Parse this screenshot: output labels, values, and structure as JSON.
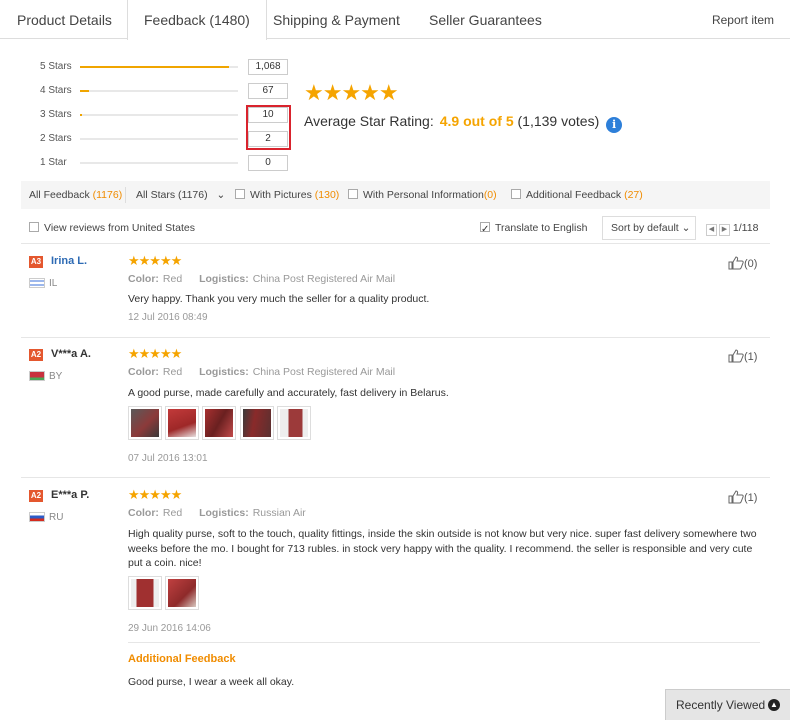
{
  "tabs": [
    {
      "label": "Product Details"
    },
    {
      "label": "Feedback (1480)"
    },
    {
      "label": "Shipping & Payment"
    },
    {
      "label": "Seller Guarantees"
    }
  ],
  "report_label": "Report item",
  "distribution": [
    {
      "label": "5 Stars",
      "count": "1,068",
      "fraction": 0.94
    },
    {
      "label": "4 Stars",
      "count": "67",
      "fraction": 0.06
    },
    {
      "label": "3 Stars",
      "count": "10",
      "fraction": 0.01
    },
    {
      "label": "2 Stars",
      "count": "2",
      "fraction": 0.0
    },
    {
      "label": "1 Star",
      "count": "0",
      "fraction": 0.0
    }
  ],
  "rating": {
    "stars": "★★★★★",
    "label": "Average Star Rating:",
    "score": "4.9 out of 5",
    "votes": "(1,139 votes)",
    "info_icon": "i"
  },
  "filters": {
    "all_feedback": "All Feedback",
    "all_feedback_count": "(1176)",
    "all_stars": "All Stars (1176)",
    "all_stars_arrow": "⌄",
    "with_pictures": "With Pictures",
    "with_pictures_count": "(130)",
    "with_personal": "With Personal Information",
    "with_personal_count": "(0)",
    "additional": "Additional Feedback",
    "additional_count": "(27)",
    "view_us": "View reviews from United States",
    "translate": "Translate to English",
    "sort": "Sort by default",
    "sort_arrow": "⌄",
    "prev": "◀",
    "next": "▶",
    "page": "1/118"
  },
  "reviews": [
    {
      "badge": "A3",
      "name": "Irina L.",
      "country": "IL",
      "stars": "★★★★★",
      "color_label": "Color:",
      "color": "Red",
      "logistics_label": "Logistics:",
      "logistics": "China Post Registered Air Mail",
      "text": "Very happy. Thank you very much the seller for a quality product.",
      "date": "12 Jul 2016 08:49",
      "likes": "(0)"
    },
    {
      "badge": "A2",
      "name": "V***a A.",
      "country": "BY",
      "stars": "★★★★★",
      "color_label": "Color:",
      "color": "Red",
      "logistics_label": "Logistics:",
      "logistics": "China Post Registered Air Mail",
      "text": "A good purse, made carefully and accurately, fast delivery in Belarus.",
      "date": "07 Jul 2016 13:01",
      "likes": "(1)"
    },
    {
      "badge": "A2",
      "name": "E***a P.",
      "country": "RU",
      "stars": "★★★★★",
      "color_label": "Color:",
      "color": "Red",
      "logistics_label": "Logistics:",
      "logistics": "Russian Air",
      "text": "High quality purse, soft to the touch, quality fittings, inside the skin outside is not know but very nice. super fast delivery somewhere two weeks before the mo. I bought for 713 rubles. in stock very happy with the quality. I recommend. the seller is responsible and very cute put a coin. nice!",
      "date": "29 Jun 2016 14:06",
      "likes": "(1)",
      "additional_label": "Additional Feedback",
      "additional_text": "Good purse, I wear a week all okay."
    }
  ],
  "recently_viewed": "Recently Viewed",
  "recent_up": "▲"
}
